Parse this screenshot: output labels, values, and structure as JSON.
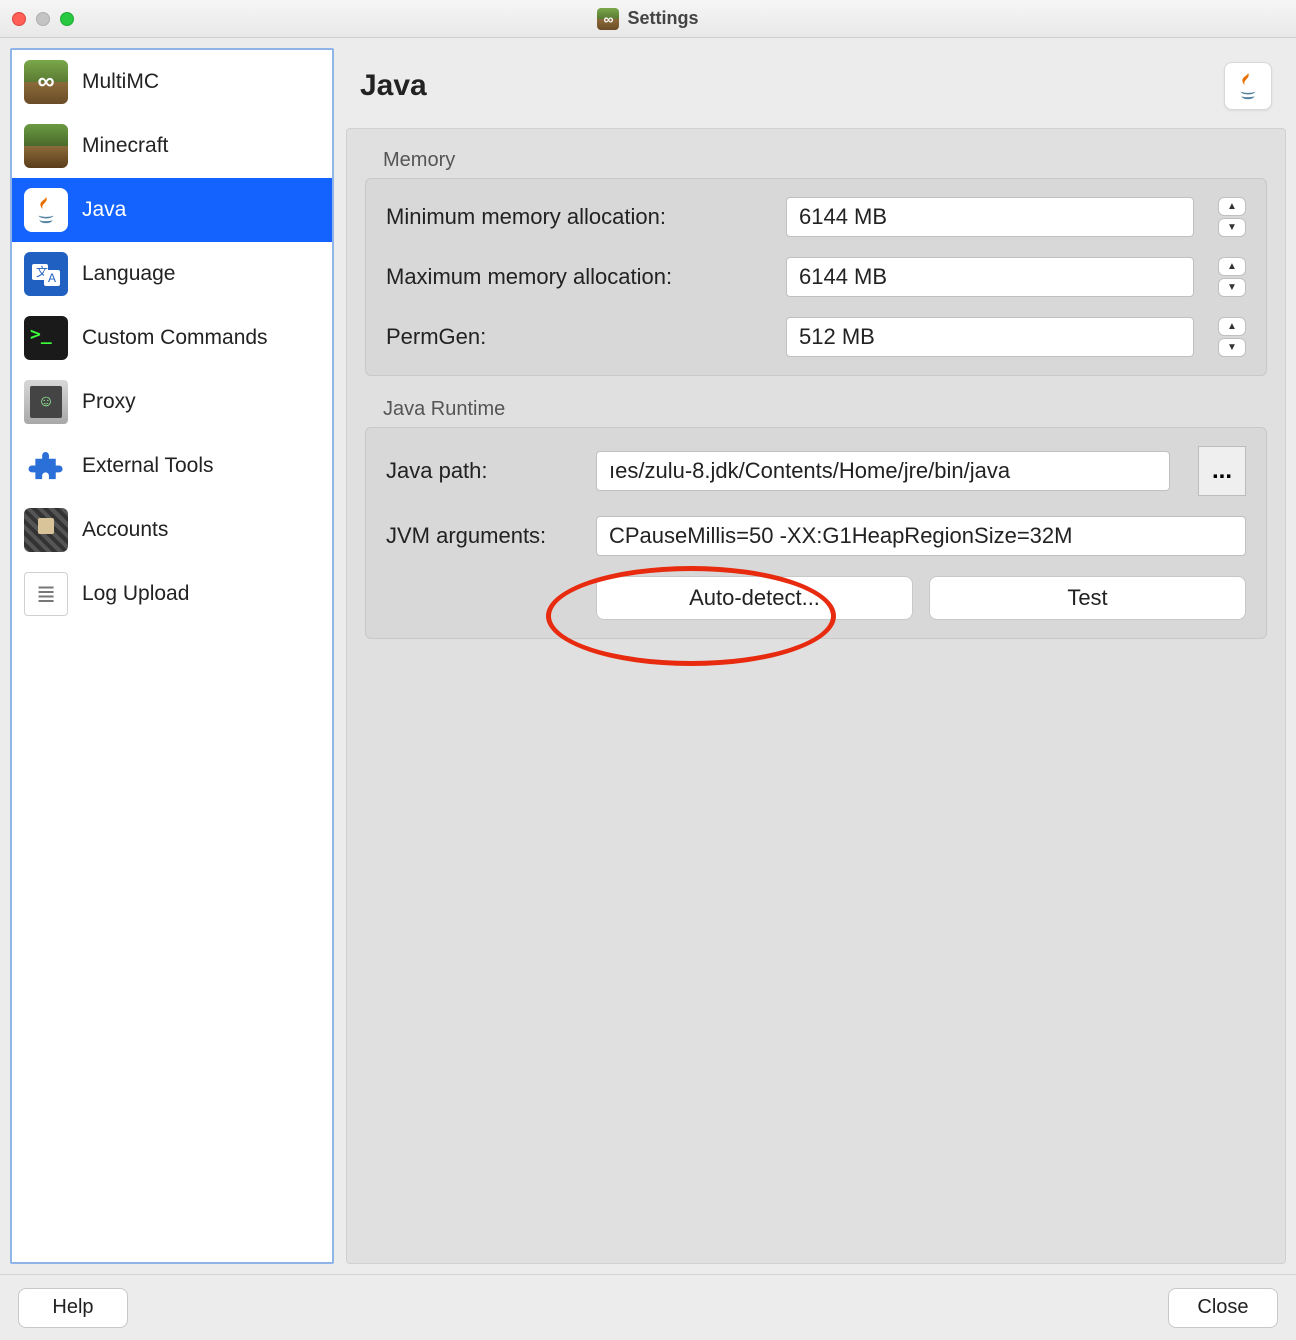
{
  "window": {
    "title": "Settings"
  },
  "sidebar": {
    "items": [
      {
        "label": "MultiMC"
      },
      {
        "label": "Minecraft"
      },
      {
        "label": "Java"
      },
      {
        "label": "Language"
      },
      {
        "label": "Custom Commands"
      },
      {
        "label": "Proxy"
      },
      {
        "label": "External Tools"
      },
      {
        "label": "Accounts"
      },
      {
        "label": "Log Upload"
      }
    ],
    "selected_index": 2
  },
  "page": {
    "title": "Java"
  },
  "memory": {
    "group_title": "Memory",
    "min_label": "Minimum memory allocation:",
    "min_value": "6144 MB",
    "max_label": "Maximum memory allocation:",
    "max_value": "6144 MB",
    "permgen_label": "PermGen:",
    "permgen_value": "512 MB"
  },
  "runtime": {
    "group_title": "Java Runtime",
    "path_label": "Java path:",
    "path_value": "ıes/zulu-8.jdk/Contents/Home/jre/bin/java",
    "browse_label": "...",
    "args_label": "JVM arguments:",
    "args_value": "CPauseMillis=50 -XX:G1HeapRegionSize=32M",
    "autodetect_label": "Auto-detect...",
    "test_label": "Test"
  },
  "footer": {
    "help": "Help",
    "close": "Close"
  }
}
